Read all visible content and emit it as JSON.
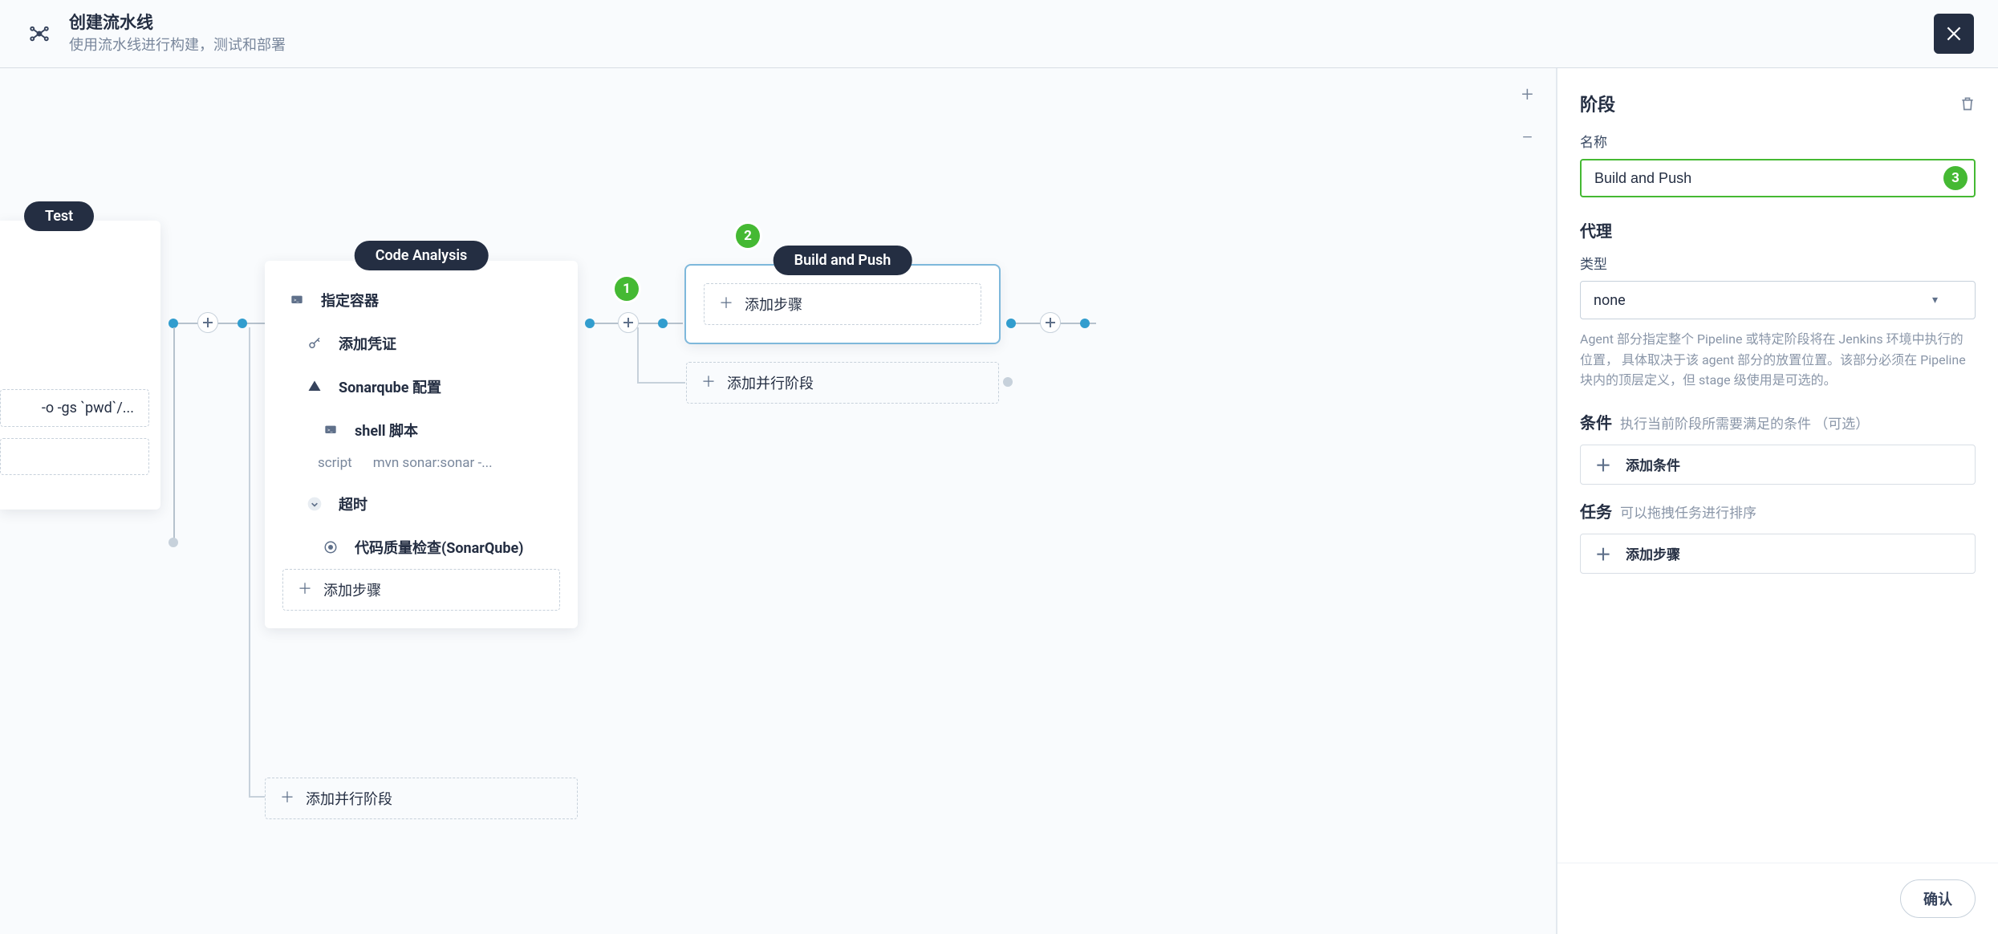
{
  "header": {
    "title": "创建流水线",
    "subtitle": "使用流水线进行构建，测试和部署"
  },
  "zoom": {
    "in": "+",
    "out": "−"
  },
  "badges": {
    "b1": "1",
    "b2": "2",
    "b3": "3"
  },
  "canvas": {
    "partial_stage": {
      "pill": "Test",
      "script_fragment": "-o -gs `pwd`/..."
    },
    "code_analysis": {
      "pill": "Code Analysis",
      "items": {
        "container": "指定容器",
        "credential": "添加凭证",
        "sonarqube": "Sonarqube 配置",
        "shell": "shell 脚本",
        "script_label": "script",
        "script_value": "mvn sonar:sonar -...",
        "timeout": "超时",
        "quality": "代码质量检查(SonarQube)"
      },
      "add_step": "添加步骤",
      "add_parallel": "添加并行阶段"
    },
    "build_push": {
      "pill": "Build and Push",
      "add_step": "添加步骤",
      "add_parallel": "添加并行阶段"
    }
  },
  "side": {
    "title": "阶段",
    "name_label": "名称",
    "name_value": "Build and Push",
    "agent_title": "代理",
    "type_label": "类型",
    "type_value": "none",
    "agent_helper": "Agent 部分指定整个 Pipeline 或特定阶段将在 Jenkins 环境中执行的位置， 具体取决于该 agent 部分的放置位置。该部分必须在 Pipeline 块内的顶层定义，但 stage 级使用是可选的。",
    "cond_title": "条件",
    "cond_sub": "执行当前阶段所需要满足的条件 （可选）",
    "add_condition": "添加条件",
    "task_title": "任务",
    "task_sub": "可以拖拽任务进行排序",
    "add_step": "添加步骤",
    "confirm": "确认"
  }
}
